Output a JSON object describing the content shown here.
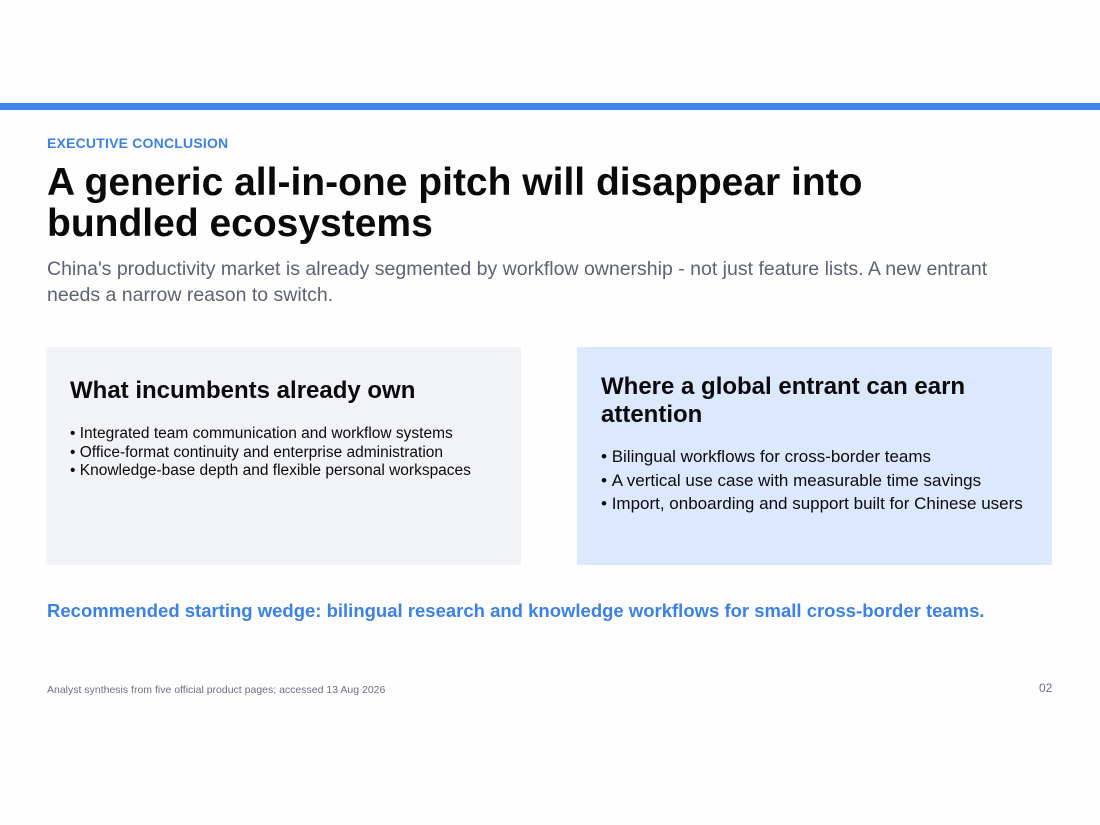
{
  "slide": {
    "eyebrow": "EXECUTIVE CONCLUSION",
    "title": "A generic all-in-one pitch will disappear into bundled ecosystems",
    "subtitle": "China's productivity market is already segmented by workflow ownership - not just feature lists. A new entrant needs a narrow reason to switch.",
    "left_card": {
      "heading": "What incumbents already own",
      "items": [
        "Integrated team communication and workflow systems",
        "Office-format continuity and enterprise administration",
        "Knowledge-base depth and flexible personal workspaces"
      ]
    },
    "right_card": {
      "heading": "Where a global entrant can earn attention",
      "items": [
        "Bilingual workflows for cross-border teams",
        "A vertical use case with measurable time savings",
        "Import, onboarding and support built for Chinese users"
      ]
    },
    "recommendation": "Recommended starting wedge: bilingual research and knowledge workflows for small cross-border teams.",
    "source_note": "Analyst synthesis from five official product pages; accessed 13 Aug 2026",
    "page_number": "02"
  },
  "colors": {
    "accent": "#3f87f0",
    "accent_text": "#3b82e6",
    "left_card_bg": "#f2f3f7",
    "right_card_bg": "#dce8fd",
    "muted_text": "#5d6274"
  }
}
